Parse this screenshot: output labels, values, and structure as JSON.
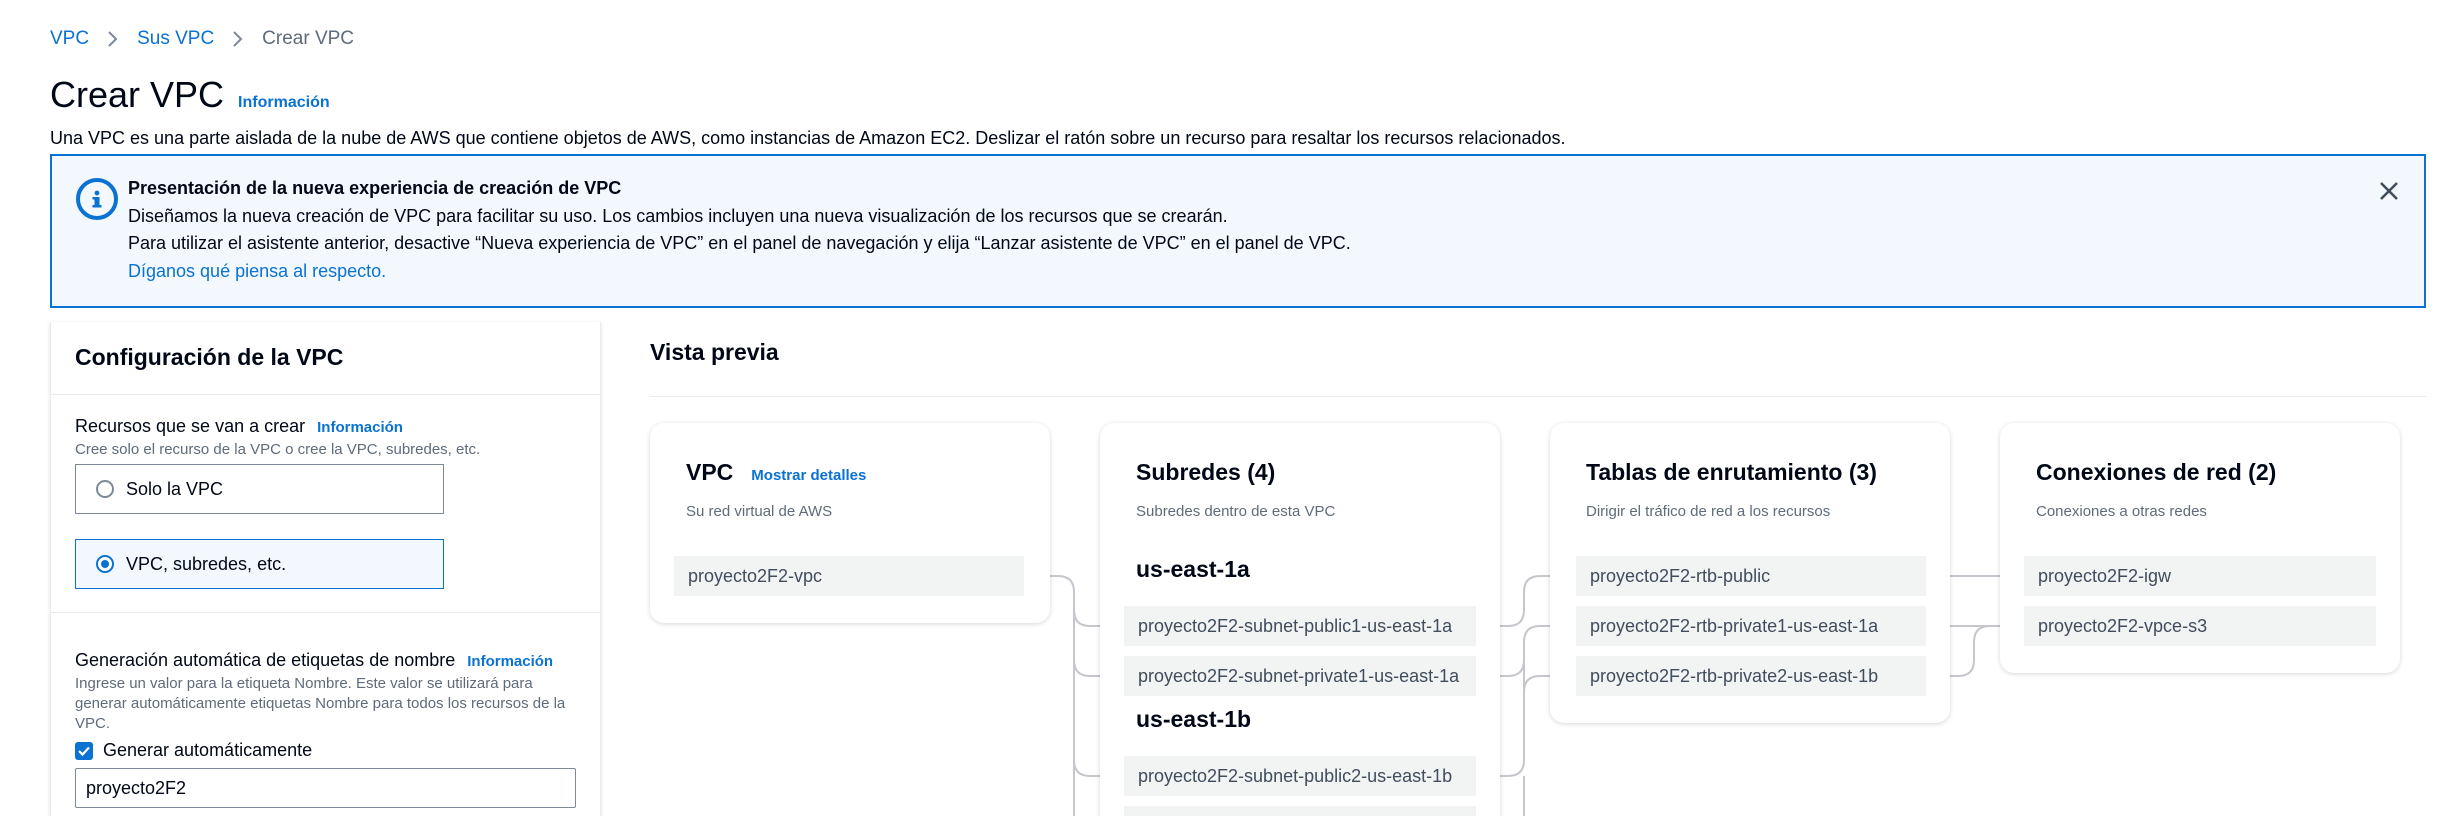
{
  "breadcrumb": {
    "items": [
      "VPC",
      "Sus VPC"
    ],
    "current": "Crear VPC"
  },
  "header": {
    "title": "Crear VPC",
    "info_label": "Información",
    "description": "Una VPC es una parte aislada de la nube de AWS que contiene objetos de AWS, como instancias de Amazon EC2. Deslizar el ratón sobre un recurso para resaltar los recursos relacionados."
  },
  "banner": {
    "title": "Presentación de la nueva experiencia de creación de VPC",
    "line1": "Diseñamos la nueva creación de VPC para facilitar su uso. Los cambios incluyen una nueva visualización de los recursos que se crearán.",
    "line2": "Para utilizar el asistente anterior, desactive “Nueva experiencia de VPC” en el panel de navegación y elija “Lanzar asistente de VPC” en el panel de VPC.",
    "feedback_link": "Díganos qué piensa al respecto.",
    "icon": "info-icon",
    "close_icon": "close-icon"
  },
  "config": {
    "title": "Configuración de la VPC",
    "resources_label": "Recursos que se van a crear",
    "resources_info": "Información",
    "resources_desc": "Cree solo el recurso de la VPC o cree la VPC, subredes, etc.",
    "options": [
      "Solo la VPC",
      "VPC, subredes, etc."
    ],
    "selected_option": "VPC, subredes, etc.",
    "name_tag_label": "Generación automática de etiquetas de nombre",
    "name_tag_info": "Información",
    "name_tag_desc": "Ingrese un valor para la etiqueta Nombre. Este valor se utilizará para generar automáticamente etiquetas Nombre para todos los recursos de la VPC.",
    "auto_generate_label": "Generar automáticamente",
    "auto_generate_checked": true,
    "name_value": "proyecto2F2"
  },
  "preview": {
    "title": "Vista previa",
    "vpc": {
      "title": "VPC",
      "details_link": "Mostrar detalles",
      "subtitle": "Su red virtual de AWS",
      "resource": "proyecto2F2-vpc"
    },
    "subnets": {
      "title": "Subredes (4)",
      "subtitle": "Subredes dentro de esta VPC",
      "az1": "us-east-1a",
      "az1_items": [
        "proyecto2F2-subnet-public1-us-east-1a",
        "proyecto2F2-subnet-private1-us-east-1a"
      ],
      "az2": "us-east-1b",
      "az2_items": [
        "proyecto2F2-subnet-public2-us-east-1b"
      ]
    },
    "route_tables": {
      "title": "Tablas de enrutamiento (3)",
      "subtitle": "Dirigir el tráfico de red a los recursos",
      "items": [
        "proyecto2F2-rtb-public",
        "proyecto2F2-rtb-private1-us-east-1a",
        "proyecto2F2-rtb-private2-us-east-1b"
      ]
    },
    "connections": {
      "title": "Conexiones de red (2)",
      "subtitle": "Conexiones a otras redes",
      "items": [
        "proyecto2F2-igw",
        "proyecto2F2-vpce-s3"
      ]
    }
  },
  "colors": {
    "link": "#0972d3",
    "banner_bg": "#f2f8fd",
    "resource_bg": "#f2f3f3",
    "connector": "#c6c6cd"
  }
}
